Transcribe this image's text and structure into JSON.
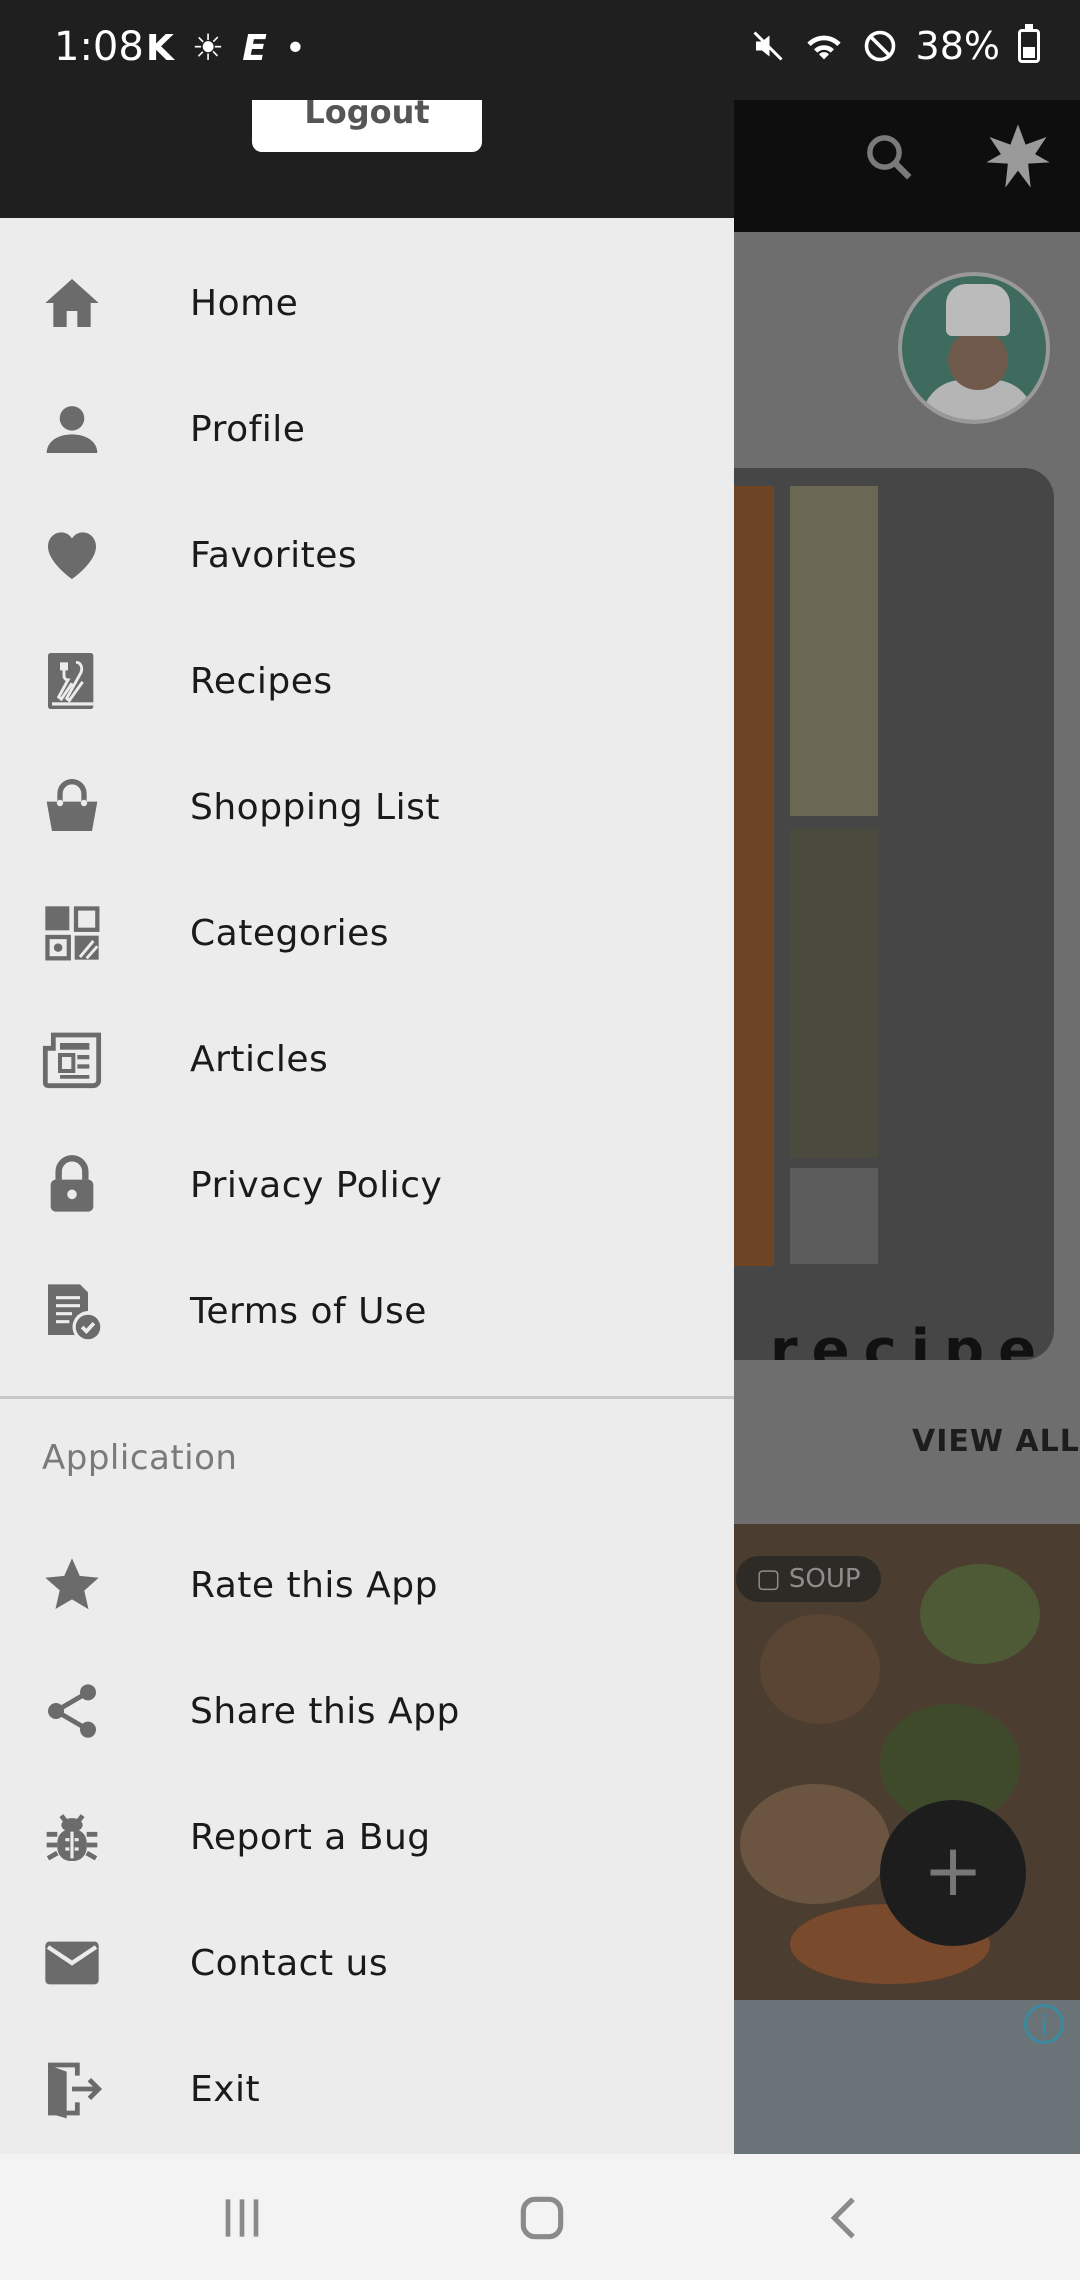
{
  "status_bar": {
    "time": "1:08",
    "left_icons": [
      "K",
      "☀",
      "E",
      "•"
    ],
    "battery": "38%",
    "battery_level": 0.38
  },
  "drawer": {
    "logout_label": "Logout",
    "items": [
      {
        "label": "Home",
        "icon": "home-icon"
      },
      {
        "label": "Profile",
        "icon": "person-icon"
      },
      {
        "label": "Favorites",
        "icon": "heart-icon"
      },
      {
        "label": "Recipes",
        "icon": "recipe-book-icon"
      },
      {
        "label": "Shopping List",
        "icon": "basket-icon"
      },
      {
        "label": "Categories",
        "icon": "categories-icon"
      },
      {
        "label": "Articles",
        "icon": "newspaper-icon"
      },
      {
        "label": "Privacy Policy",
        "icon": "lock-icon"
      },
      {
        "label": "Terms of Use",
        "icon": "terms-icon"
      }
    ],
    "section_label": "Application",
    "app_items": [
      {
        "label": "Rate this App",
        "icon": "star-icon"
      },
      {
        "label": "Share this App",
        "icon": "share-icon"
      },
      {
        "label": "Report a Bug",
        "icon": "bug-icon"
      },
      {
        "label": "Contact us",
        "icon": "mail-icon"
      },
      {
        "label": "Exit",
        "icon": "exit-icon"
      }
    ]
  },
  "background": {
    "view_all": "VIEW ALL",
    "card_word": "recipe",
    "category_badge": "SOUP",
    "fab": "+",
    "ad_info": "i"
  },
  "colors": {
    "drawer_bg": "#ececec",
    "header_bg": "#1f1f1f",
    "icon": "#6b6b6b",
    "text": "#1a1a1a",
    "section": "#7a7a7a"
  }
}
